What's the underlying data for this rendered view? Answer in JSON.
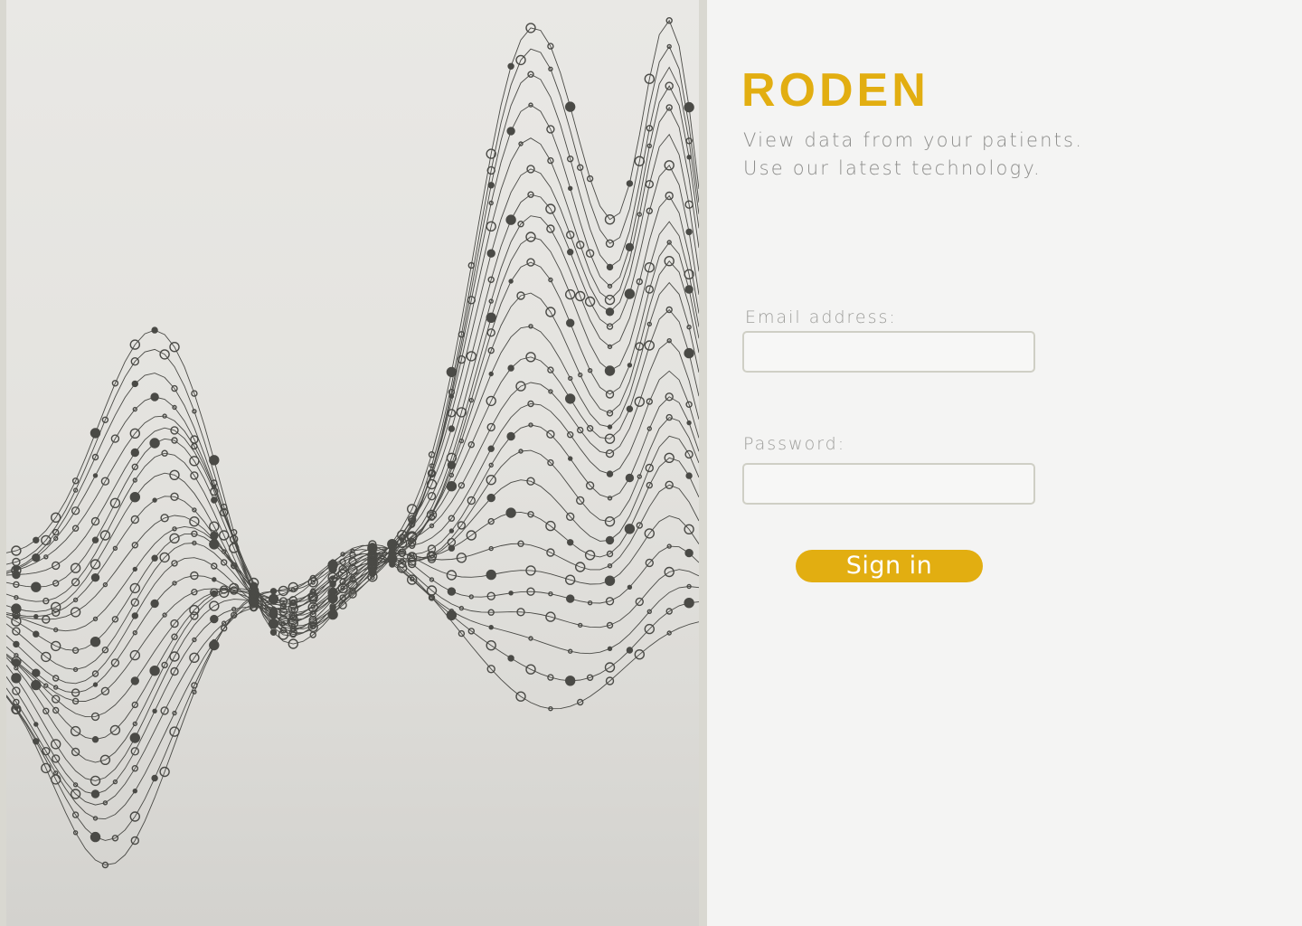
{
  "brand": {
    "name": "RODEN",
    "color": "#e2ae11"
  },
  "tagline": {
    "line1": "View data from your patients.",
    "line2": "Use our latest technology."
  },
  "login_form": {
    "email_label": "Email address:",
    "email_value": "",
    "password_label": "Password:",
    "password_value": "",
    "submit_label": "Sign in"
  },
  "hero": {
    "illustration": "abstract-data-wave-illustration"
  }
}
